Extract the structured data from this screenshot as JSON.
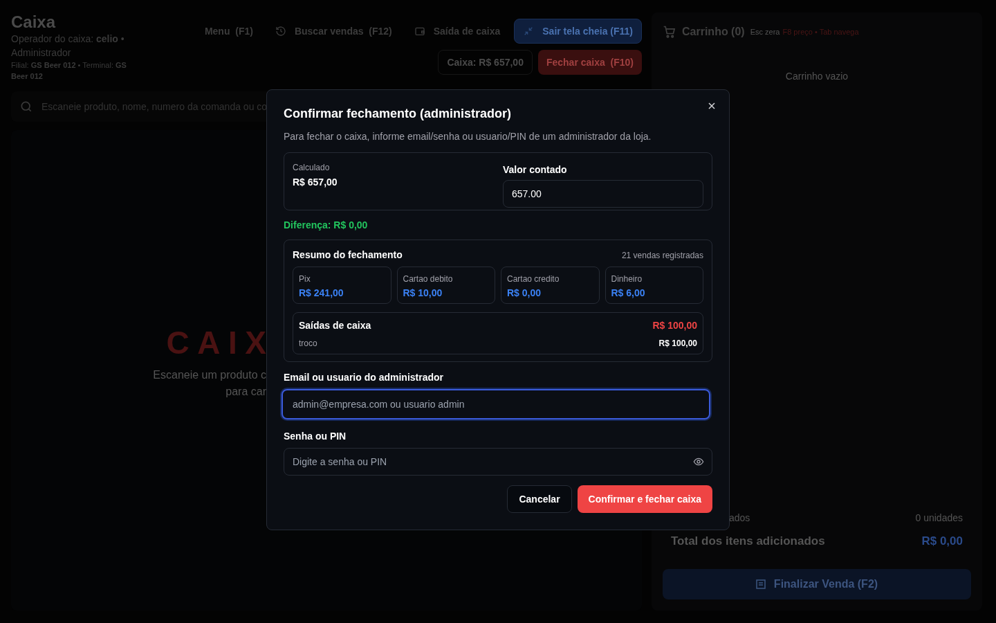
{
  "header": {
    "title": "Caixa",
    "operator": "Operador do caixa: **celio** • Administrador",
    "location": "Filial: **GS Beer 012** • Terminal: **GS Beer 012**"
  },
  "toolbar": [
    {
      "label": "Menu  (F1)",
      "kind": "plain"
    },
    {
      "label": "Buscar vendas  (F12)",
      "kind": "plain"
    },
    {
      "label": "Saída de caixa",
      "kind": "plain"
    },
    {
      "label": "Sair tela cheia (F11)",
      "kind": "primary"
    }
  ],
  "toolbar_2": [
    {
      "label": "Caixa: R$ 657,00",
      "kind": "outline"
    },
    {
      "label": "Fechar caixa  (F10)",
      "kind": "danger"
    }
  ],
  "search": {
    "placeholder": "Escaneie produto, nome, numero da comanda ou co"
  },
  "empty_state": {
    "title": "CAIX",
    "lines": [
      "Escaneie um produto c",
      "para car"
    ]
  },
  "cart": {
    "title": "Carrinho (0)",
    "hint": "Esc zera",
    "hint_accent": "F8 preço • Tab navega",
    "empty": "Carrinho vazio",
    "items_label": "ados",
    "units": "0 unidades",
    "total_label": "Total dos itens adicionados",
    "total": "R$ 0,00",
    "checkout": "Finalizar Venda (F2)"
  },
  "modal": {
    "title": "Confirmar fechamento (administrador)",
    "description": "Para fechar o caixa, informe email/senha ou usuario/PIN de um administrador da loja.",
    "calculated_label": "Calculado",
    "calculated": "R$ 657,00",
    "counted_label": "Valor contado",
    "counted_value": "657.00",
    "difference": "Diferença: R$ 0,00",
    "summary": {
      "title": "Resumo do fechamento",
      "count": "21 vendas registradas",
      "methods": [
        {
          "label": "Pix",
          "amount": "R$ 241,00"
        },
        {
          "label": "Cartao debito",
          "amount": "R$ 10,00"
        },
        {
          "label": "Cartao credito",
          "amount": "R$ 0,00"
        },
        {
          "label": "Dinheiro",
          "amount": "R$ 6,00"
        }
      ],
      "withdrawals": {
        "title": "Saídas de caixa",
        "total": "R$ 100,00",
        "items": [
          {
            "label": "troco",
            "amount": "R$ 100,00"
          }
        ]
      }
    },
    "fields": [
      {
        "label": "Email ou usuario do administrador",
        "placeholder": "admin@empresa.com ou usuario admin",
        "focused": true,
        "kind": "text"
      },
      {
        "label": "Senha ou PIN",
        "placeholder": "Digite a senha ou PIN",
        "focused": false,
        "kind": "password"
      }
    ],
    "buttons": [
      {
        "label": "Cancelar",
        "kind": "secondary"
      },
      {
        "label": "Confirmar e fechar caixa",
        "kind": "danger"
      }
    ]
  }
}
